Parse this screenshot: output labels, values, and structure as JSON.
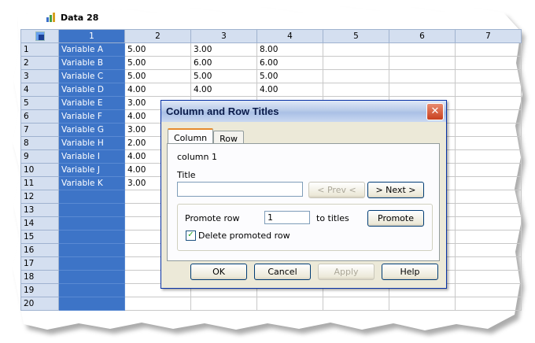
{
  "document": {
    "tab_label": "Data 28"
  },
  "grid": {
    "columns": [
      "1",
      "2",
      "3",
      "4",
      "5",
      "6",
      "7"
    ],
    "rows": [
      {
        "n": "1",
        "c": [
          "Variable A",
          "5.00",
          "3.00",
          "8.00"
        ]
      },
      {
        "n": "2",
        "c": [
          "Variable B",
          "5.00",
          "6.00",
          "6.00"
        ]
      },
      {
        "n": "3",
        "c": [
          "Variable C",
          "5.00",
          "5.00",
          "5.00"
        ]
      },
      {
        "n": "4",
        "c": [
          "Variable D",
          "4.00",
          "4.00",
          "4.00"
        ]
      },
      {
        "n": "5",
        "c": [
          "Variable E",
          "3.00",
          "",
          ""
        ]
      },
      {
        "n": "6",
        "c": [
          "Variable F",
          "4.00",
          "",
          ""
        ]
      },
      {
        "n": "7",
        "c": [
          "Variable G",
          "3.00",
          "",
          ""
        ]
      },
      {
        "n": "8",
        "c": [
          "Variable H",
          "2.00",
          "",
          ""
        ]
      },
      {
        "n": "9",
        "c": [
          "Variable I",
          "4.00",
          "",
          ""
        ]
      },
      {
        "n": "10",
        "c": [
          "Variable J",
          "4.00",
          "",
          ""
        ]
      },
      {
        "n": "11",
        "c": [
          "Variable K",
          "3.00",
          "",
          ""
        ]
      },
      {
        "n": "12",
        "c": [
          "",
          "",
          "",
          ""
        ]
      },
      {
        "n": "13",
        "c": [
          "",
          "",
          "",
          ""
        ]
      },
      {
        "n": "14",
        "c": [
          "",
          "",
          "",
          ""
        ]
      },
      {
        "n": "15",
        "c": [
          "",
          "",
          "",
          ""
        ]
      },
      {
        "n": "16",
        "c": [
          "",
          "",
          "",
          ""
        ]
      },
      {
        "n": "17",
        "c": [
          "",
          "",
          "",
          ""
        ]
      },
      {
        "n": "18",
        "c": [
          "",
          "",
          "",
          ""
        ]
      },
      {
        "n": "19",
        "c": [
          "",
          "",
          "",
          ""
        ]
      },
      {
        "n": "20",
        "c": [
          "",
          "",
          "",
          ""
        ]
      }
    ]
  },
  "dialog": {
    "title": "Column and Row Titles",
    "close_glyph": "✕",
    "tabs": {
      "column": "Column",
      "row": "Row"
    },
    "column_label": "column 1",
    "title_label": "Title",
    "title_value": "",
    "prev_button": "< Prev <",
    "next_button": "> Next >",
    "promote_row_label": "Promote row",
    "promote_row_value": "1",
    "to_titles_label": "to titles",
    "promote_button": "Promote",
    "delete_promoted_label": "Delete promoted row",
    "delete_promoted_checked": true,
    "ok_button": "OK",
    "cancel_button": "Cancel",
    "apply_button": "Apply",
    "help_button": "Help"
  }
}
